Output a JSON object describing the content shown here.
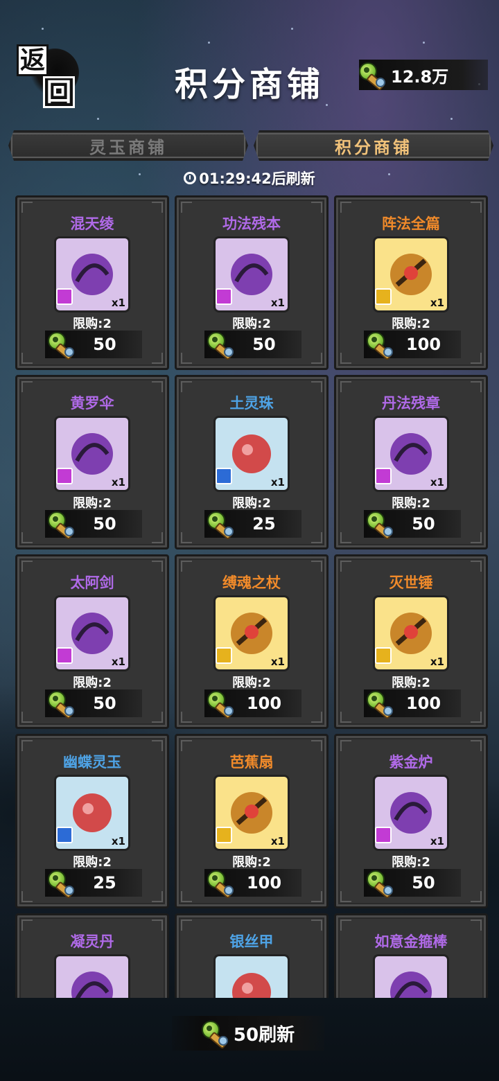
{
  "header": {
    "back_label_top": "返",
    "back_label_bottom": "回",
    "title": "积分商铺",
    "points": "12.8万"
  },
  "tabs": [
    {
      "label": "灵玉商铺",
      "active": false
    },
    {
      "label": "积分商铺",
      "active": true
    }
  ],
  "timer": "01:29:42后刷新",
  "items": [
    {
      "name": "混天绫",
      "rarity": "purple",
      "qty": "x1",
      "limit": "限购:2",
      "price": "50",
      "icon": "red-ribbon-icon"
    },
    {
      "name": "功法残本",
      "rarity": "purple",
      "qty": "x1",
      "limit": "限购:2",
      "price": "50",
      "icon": "book-fragment-icon"
    },
    {
      "name": "阵法全篇",
      "rarity": "orange",
      "qty": "x1",
      "limit": "限购:2",
      "price": "100",
      "icon": "formation-scroll-icon"
    },
    {
      "name": "黄罗伞",
      "rarity": "purple",
      "qty": "x1",
      "limit": "限购:2",
      "price": "50",
      "icon": "umbrella-icon"
    },
    {
      "name": "土灵珠",
      "rarity": "blue",
      "qty": "x1",
      "limit": "限购:2",
      "price": "25",
      "icon": "earth-orb-icon"
    },
    {
      "name": "丹法残章",
      "rarity": "purple",
      "qty": "x1",
      "limit": "限购:2",
      "price": "50",
      "icon": "alchemy-book-icon"
    },
    {
      "name": "太阿剑",
      "rarity": "purple",
      "qty": "x1",
      "limit": "限购:2",
      "price": "50",
      "icon": "sword-icon"
    },
    {
      "name": "缚魂之杖",
      "rarity": "orange",
      "qty": "x1",
      "limit": "限购:2",
      "price": "100",
      "icon": "soul-staff-icon"
    },
    {
      "name": "灭世锤",
      "rarity": "orange",
      "qty": "x1",
      "limit": "限购:2",
      "price": "100",
      "icon": "axe-hammer-icon"
    },
    {
      "name": "幽蝶灵玉",
      "rarity": "blue",
      "qty": "x1",
      "limit": "限购:2",
      "price": "25",
      "icon": "butterfly-jade-icon"
    },
    {
      "name": "芭蕉扇",
      "rarity": "orange",
      "qty": "x1",
      "limit": "限购:2",
      "price": "100",
      "icon": "fan-icon"
    },
    {
      "name": "紫金炉",
      "rarity": "purple",
      "qty": "x1",
      "limit": "限购:2",
      "price": "50",
      "icon": "cauldron-icon"
    },
    {
      "name": "凝灵丹",
      "rarity": "purple",
      "qty": "",
      "limit": "",
      "price": "",
      "icon": "spirit-pill-icon"
    },
    {
      "name": "银丝甲",
      "rarity": "blue",
      "qty": "",
      "limit": "",
      "price": "",
      "icon": "silk-armor-icon"
    },
    {
      "name": "如意金箍棒",
      "rarity": "purple",
      "qty": "",
      "limit": "",
      "price": "",
      "icon": "golden-staff-icon"
    }
  ],
  "refresh_button": {
    "cost": "50刷新"
  },
  "colors": {
    "purple": "#b06ae8",
    "orange": "#f08a2a",
    "blue": "#4ea3e6",
    "tab_active": "#f1c27a"
  }
}
